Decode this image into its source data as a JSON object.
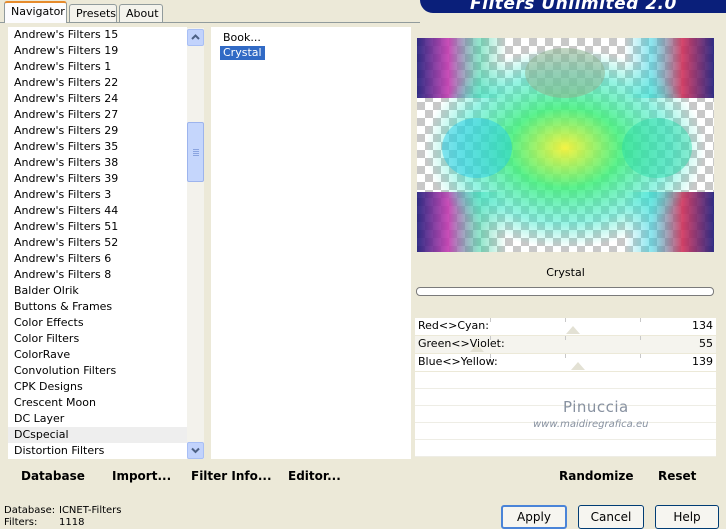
{
  "tabs": [
    {
      "label": "Navigator",
      "active": true
    },
    {
      "label": "Presets",
      "active": false
    },
    {
      "label": "About",
      "active": false
    }
  ],
  "app_title": "Filters Unlimited 2.0",
  "filter_categories": [
    "Andrew's Filters 15",
    "Andrew's Filters 19",
    "Andrew's Filters 1",
    "Andrew's Filters 22",
    "Andrew's Filters 24",
    "Andrew's Filters 27",
    "Andrew's Filters 29",
    "Andrew's Filters 35",
    "Andrew's Filters 38",
    "Andrew's Filters 39",
    "Andrew's Filters 3",
    "Andrew's Filters 44",
    "Andrew's Filters 51",
    "Andrew's Filters 52",
    "Andrew's Filters 6",
    "Andrew's Filters 8",
    "Balder Olrik",
    "Buttons & Frames",
    "Color Effects",
    "Color Filters",
    "ColorRave",
    "Convolution Filters",
    "CPK Designs",
    "Crescent Moon",
    "DC Layer",
    "DCspecial",
    "Distortion Filters"
  ],
  "selected_category": "DCspecial",
  "effects": [
    {
      "label": "Book...",
      "selected": false
    },
    {
      "label": "Crystal",
      "selected": true
    }
  ],
  "toolbar": {
    "database": "Database",
    "import": "Import...",
    "filter_info": "Filter Info...",
    "editor": "Editor...",
    "randomize": "Randomize",
    "reset": "Reset"
  },
  "current_filter": "Crystal",
  "sliders": [
    {
      "label": "Red<>Cyan:",
      "value": "134"
    },
    {
      "label": "Green<>Violet:",
      "value": "55"
    },
    {
      "label": "Blue<>Yellow:",
      "value": "139"
    }
  ],
  "watermark": {
    "name": "Pinuccia",
    "site": "www.maidiregrafica.eu"
  },
  "status": {
    "database_label": "Database:",
    "database_value": "ICNET-Filters",
    "filters_label": "Filters:",
    "filters_value": "1118"
  },
  "buttons": {
    "apply": "Apply",
    "cancel": "Cancel",
    "help": "Help"
  }
}
